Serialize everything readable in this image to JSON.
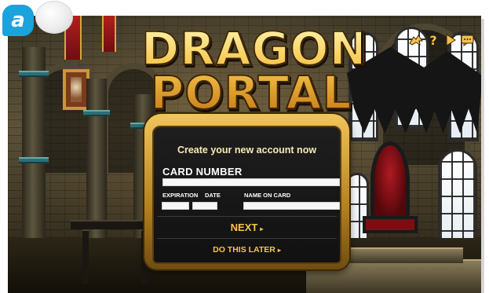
{
  "panel_label": "a",
  "game": {
    "title_line1": "DRAGON",
    "title_line2": "PORTAL"
  },
  "toolbar": {
    "icons": [
      "dragon-icon",
      "help-icon",
      "play-icon",
      "chat-icon"
    ],
    "help_glyph": "?",
    "play_glyph": "▶",
    "chat_glyph": "💬"
  },
  "form": {
    "heading": "Create your new account now",
    "card_number_label": "CARD NUMBER",
    "expiration_label": "EXPIRATION",
    "date_label": "DATE",
    "name_label": "NAME ON CARD",
    "card_number_value": "",
    "exp_month_value": "",
    "exp_year_value": "",
    "name_value": "",
    "next_label": "NEXT",
    "later_label": "DO THIS LATER",
    "arrow": "▸"
  },
  "colors": {
    "accent_gold": "#f6c54a",
    "badge_blue": "#1aa3dd",
    "panel_bg": "#151515"
  }
}
